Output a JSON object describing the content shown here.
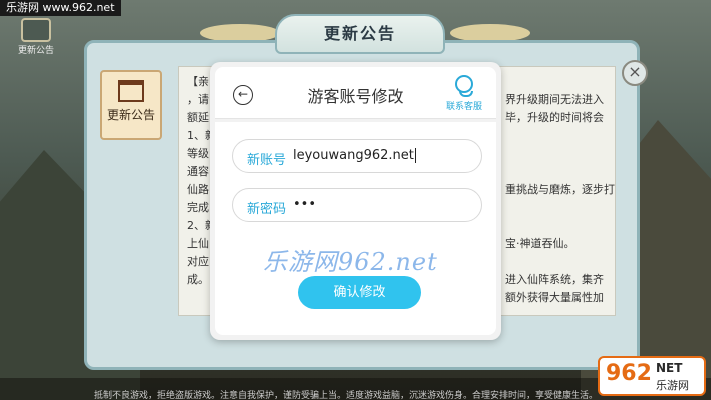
{
  "watermark_top": "乐游网 www.962.net",
  "corner": {
    "label": "更新公告"
  },
  "notice": {
    "title": "更新公告",
    "tab_label": "更新公告",
    "close_symbol": "×",
    "lines": [
      "【亲",
      "，请",
      "额延",
      "1、新",
      "等级",
      "通容",
      "仙路",
      "完成",
      "2、新",
      "上仙",
      "对应",
      "成。"
    ],
    "right_lines": [
      "界升级期间无法进入",
      "毕，升级的时间将会",
      "",
      "",
      "重挑战与磨炼，逐步打",
      "",
      "",
      "宝·神道吞仙。",
      "",
      "进入仙阵系统，集齐",
      "额外获得大量属性加",
      ""
    ],
    "footer": "抵制不良游戏，拒绝盗版游戏。注意自我保护，谨防受骗上当。适度游戏益脑，沉迷游戏伤身。合理安排时间，享受健康生活。"
  },
  "modal": {
    "title": "游客账号修改",
    "back_symbol": "←",
    "support_label": "联系客服",
    "account_label": "新账号",
    "account_value": "leyouwang962.net",
    "password_label": "新密码",
    "password_value": "•••",
    "confirm_label": "确认修改"
  },
  "watermark_mid": "乐游网962.net",
  "logo": {
    "num": "962",
    "net": "NET",
    "zh": "乐游网"
  }
}
